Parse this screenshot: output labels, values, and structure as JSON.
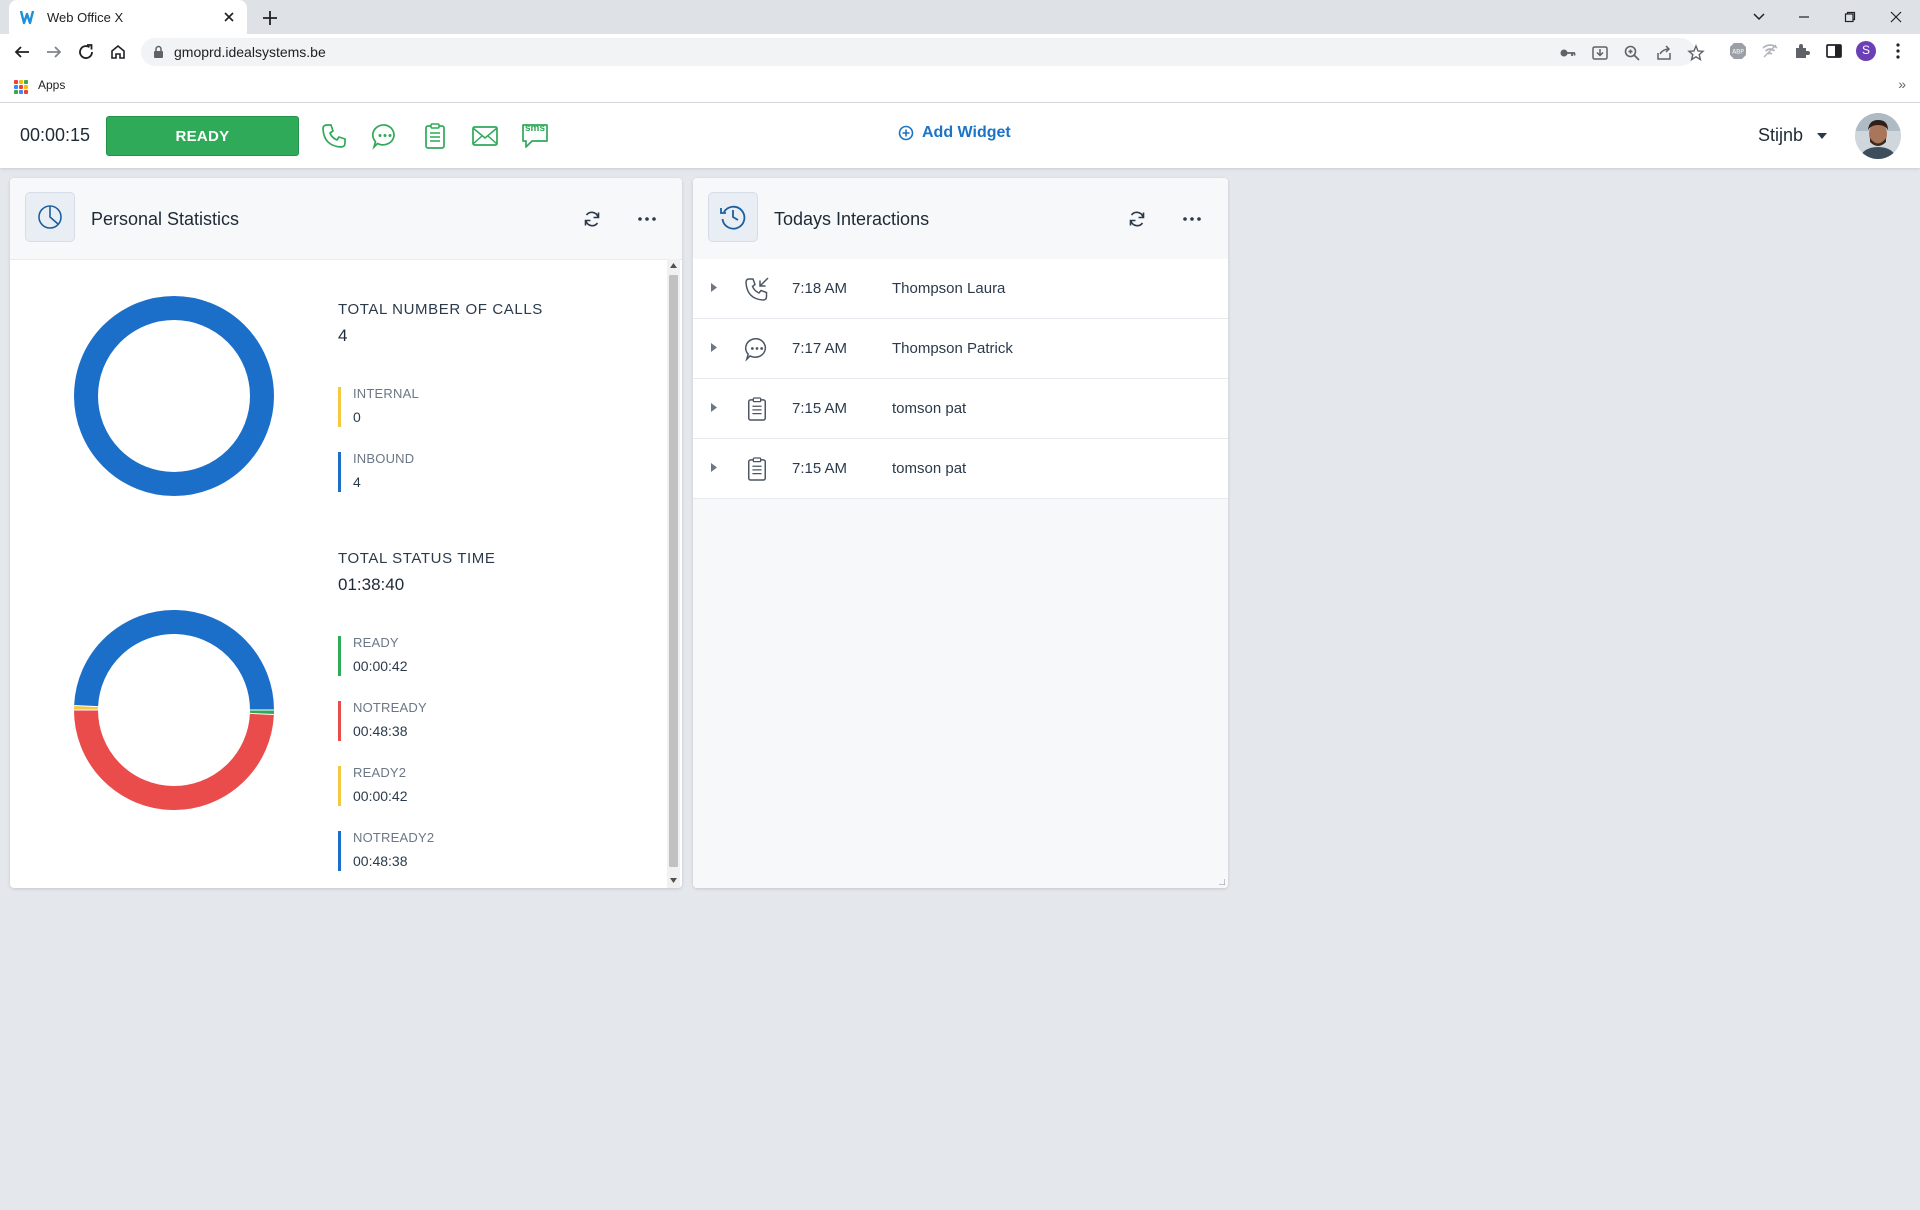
{
  "browser": {
    "tab_title": "Web Office X",
    "url": "gmoprd.idealsystems.be",
    "bookmarks_apps_label": "Apps",
    "bookmarks_more": "»",
    "profile_initial": "S"
  },
  "header": {
    "timer": "00:00:15",
    "status_button": "READY",
    "add_widget_label": "Add Widget",
    "username": "Stijnb",
    "sms_label": "sms"
  },
  "personal_statistics": {
    "title": "Personal Statistics",
    "calls": {
      "label": "TOTAL NUMBER OF CALLS",
      "total": "4",
      "items": [
        {
          "name": "INTERNAL",
          "value": "0",
          "color": "#f5c842"
        },
        {
          "name": "INBOUND",
          "value": "4",
          "color": "#1b6fc9"
        }
      ]
    },
    "status_time": {
      "label": "TOTAL STATUS TIME",
      "total": "01:38:40",
      "items": [
        {
          "name": "READY",
          "value": "00:00:42",
          "color": "#2eaa59"
        },
        {
          "name": "NOTREADY",
          "value": "00:48:38",
          "color": "#ea4b4b"
        },
        {
          "name": "READY2",
          "value": "00:00:42",
          "color": "#f5c842"
        },
        {
          "name": "NOTREADY2",
          "value": "00:48:38",
          "color": "#1b6fc9"
        }
      ]
    }
  },
  "chart_data": [
    {
      "type": "pie",
      "categories": [
        "INTERNAL",
        "INBOUND"
      ],
      "values": [
        0,
        4
      ],
      "colors": [
        "#f5c842",
        "#1b6fc9"
      ]
    },
    {
      "type": "pie",
      "categories": [
        "READY",
        "NOTREADY",
        "READY2",
        "NOTREADY2"
      ],
      "values": [
        42,
        2918,
        42,
        2918
      ],
      "colors": [
        "#2eaa59",
        "#ea4b4b",
        "#f5c842",
        "#1b6fc9"
      ]
    }
  ],
  "todays_interactions": {
    "title": "Todays Interactions",
    "rows": [
      {
        "icon": "inbound-call-icon",
        "time": "7:18 AM",
        "name": "Thompson Laura"
      },
      {
        "icon": "chat-icon",
        "time": "7:17 AM",
        "name": "Thompson Patrick"
      },
      {
        "icon": "clipboard-icon",
        "time": "7:15 AM",
        "name": "tomson pat"
      },
      {
        "icon": "clipboard-icon",
        "time": "7:15 AM",
        "name": "tomson pat"
      }
    ]
  }
}
